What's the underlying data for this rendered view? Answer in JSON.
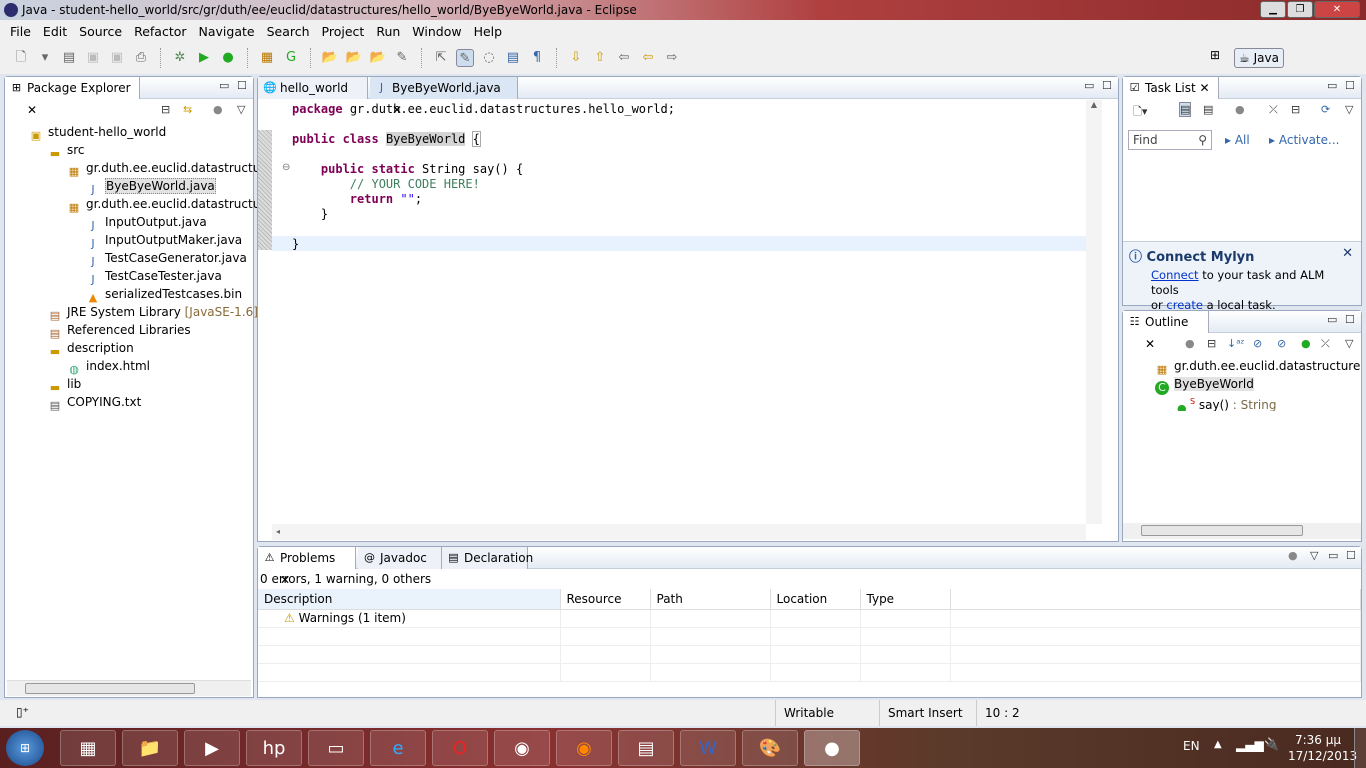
{
  "window": {
    "title": "Java - student-hello_world/src/gr/duth/ee/euclid/datastructures/hello_world/ByeByeWorld.java - Eclipse"
  },
  "menu": [
    "File",
    "Edit",
    "Source",
    "Refactor",
    "Navigate",
    "Search",
    "Project",
    "Run",
    "Window",
    "Help"
  ],
  "perspective": {
    "label": "Java"
  },
  "package_explorer": {
    "title": "Package Explorer",
    "tree": [
      {
        "label": "student-hello_world",
        "icon": "project-icon",
        "depth": 0
      },
      {
        "label": "src",
        "icon": "folder-icon",
        "depth": 1
      },
      {
        "label": "gr.duth.ee.euclid.datastructures.hello_world",
        "icon": "package-icon",
        "depth": 2
      },
      {
        "label": "ByeByeWorld.java",
        "icon": "java-file-icon",
        "depth": 3,
        "selected": true
      },
      {
        "label": "gr.duth.ee.euclid.datastructures.hello_world.utils",
        "icon": "package-icon",
        "depth": 2
      },
      {
        "label": "InputOutput.java",
        "icon": "java-file-icon",
        "depth": 3
      },
      {
        "label": "InputOutputMaker.java",
        "icon": "java-file-icon",
        "depth": 3
      },
      {
        "label": "TestCaseGenerator.java",
        "icon": "java-file-icon",
        "depth": 3
      },
      {
        "label": "TestCaseTester.java",
        "icon": "java-file-icon",
        "depth": 3
      },
      {
        "label": "serializedTestcases.bin",
        "icon": "bin-file-icon",
        "depth": 3
      },
      {
        "label": "JRE System Library",
        "suffix": "[JavaSE-1.6]",
        "icon": "library-icon",
        "depth": 1
      },
      {
        "label": "Referenced Libraries",
        "icon": "library-icon",
        "depth": 1
      },
      {
        "label": "description",
        "icon": "folder-icon",
        "depth": 1
      },
      {
        "label": "index.html",
        "icon": "web-icon",
        "depth": 2
      },
      {
        "label": "lib",
        "icon": "folder-icon",
        "depth": 1
      },
      {
        "label": "COPYING.txt",
        "icon": "text-file-icon",
        "depth": 1
      }
    ]
  },
  "editor": {
    "tabs": [
      {
        "label": "hello_world"
      },
      {
        "label": "ByeByeWorld.java",
        "active": true
      }
    ],
    "lines": [
      "package gr.duth.ee.euclid.datastructures.hello_world;",
      "",
      "public class ByeByeWorld {",
      "",
      "    public static String say() {",
      "        // YOUR CODE HERE!",
      "        return \"\";",
      "    }",
      "",
      "}"
    ]
  },
  "task_list": {
    "title": "Task List",
    "find_placeholder": "Find",
    "all": "All",
    "activate": "Activate..."
  },
  "mylyn": {
    "title": "Connect Mylyn",
    "connect": "Connect",
    "text1": " to your task and ALM tools",
    "or": "or ",
    "create": "create",
    "text2": " a local task."
  },
  "outline": {
    "title": "Outline",
    "items": [
      {
        "label": "gr.duth.ee.euclid.datastructures.hello_world"
      },
      {
        "label": "ByeByeWorld"
      },
      {
        "label": "say()",
        "type": " : String"
      }
    ]
  },
  "problems": {
    "tabs": [
      "Problems",
      "Javadoc",
      "Declaration"
    ],
    "summary": "0 errors, 1 warning, 0 others",
    "columns": [
      "Description",
      "Resource",
      "Path",
      "Location",
      "Type"
    ],
    "rows": [
      {
        "description": "Warnings (1 item)"
      }
    ]
  },
  "status": {
    "writable": "Writable",
    "insert": "Smart Insert",
    "position": "10 : 2"
  },
  "taskbar": {
    "lang": "EN",
    "time": "7:36 μμ",
    "date": "17/12/2013"
  }
}
